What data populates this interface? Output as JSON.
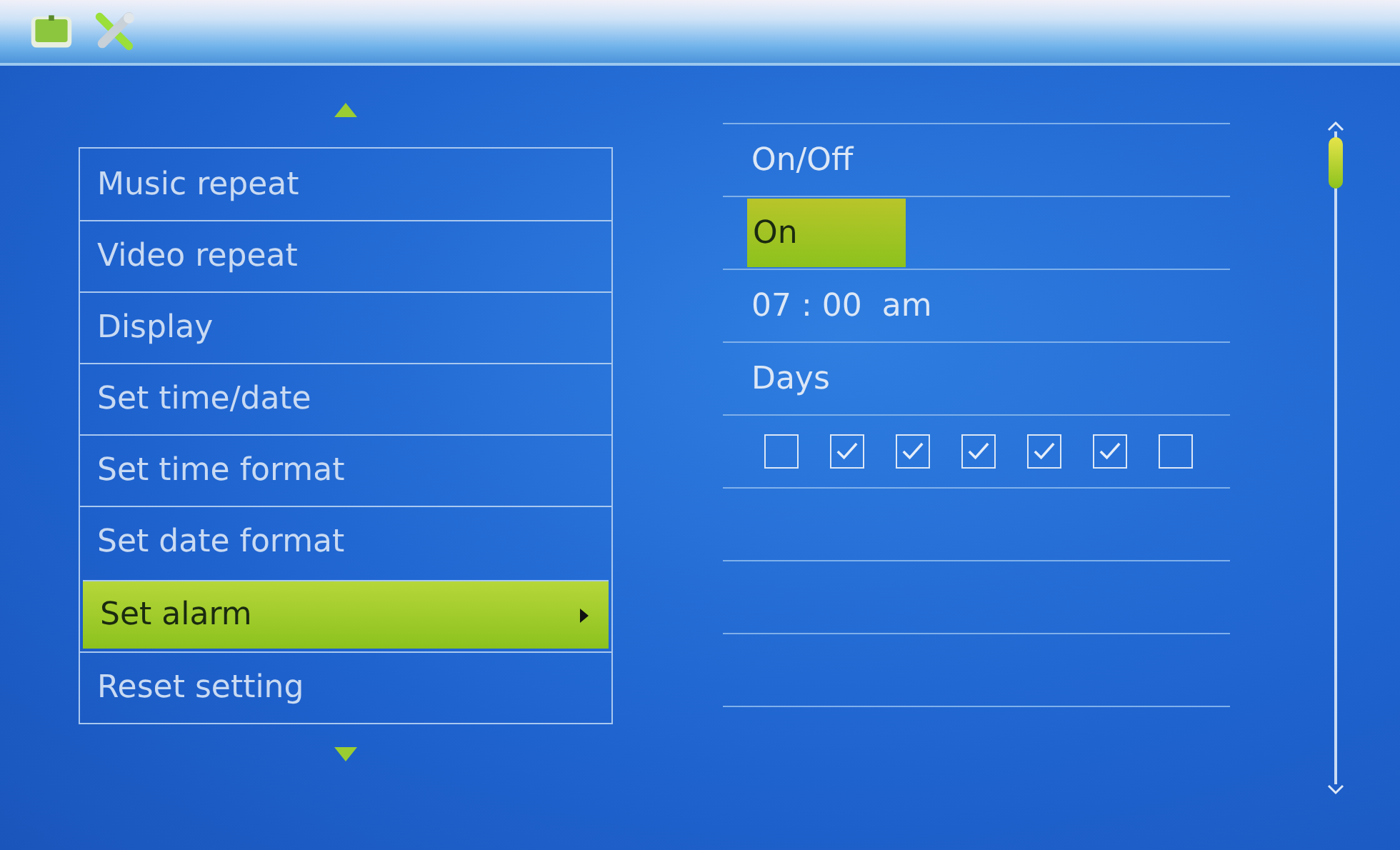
{
  "menu": {
    "items": [
      {
        "label": "Music repeat",
        "selected": false
      },
      {
        "label": "Video repeat",
        "selected": false
      },
      {
        "label": "Display",
        "selected": false
      },
      {
        "label": "Set time/date",
        "selected": false
      },
      {
        "label": "Set time format",
        "selected": false
      },
      {
        "label": "Set date format",
        "selected": false
      },
      {
        "label": "Set alarm",
        "selected": true
      },
      {
        "label": "Reset setting",
        "selected": false
      }
    ]
  },
  "alarm": {
    "on_off_label": "On/Off",
    "on_off_value": "On",
    "time": "07 : 00  am",
    "days_label": "Days",
    "days": [
      {
        "checked": false
      },
      {
        "checked": true
      },
      {
        "checked": true
      },
      {
        "checked": true
      },
      {
        "checked": true
      },
      {
        "checked": true
      },
      {
        "checked": false
      }
    ]
  }
}
